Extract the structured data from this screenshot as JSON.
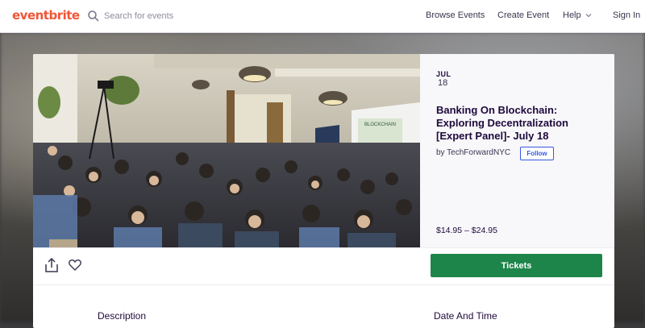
{
  "nav": {
    "logo": "eventbrite",
    "search_placeholder": "Search for events",
    "links": {
      "browse": "Browse Events",
      "create": "Create Event",
      "help": "Help",
      "signin": "Sign In"
    }
  },
  "event": {
    "month": "JUL",
    "day": "18",
    "title": "Banking On Blockchain: Exploring Decentralization [Expert Panel]- July 18",
    "organizer_prefix": "by",
    "organizer": "TechForwardNYC",
    "follow_label": "Follow",
    "price": "$14.95 – $24.95",
    "tickets_label": "Tickets"
  },
  "sections": {
    "description": "Description",
    "date_time": "Date And Time"
  },
  "slide": {
    "text": "BLOCKCHAIN"
  },
  "icons": {
    "search": "search-icon",
    "share": "share-icon",
    "like": "heart-icon",
    "help_chevron": "chevron-down-icon"
  },
  "colors": {
    "brand": "#f05537",
    "tickets": "#1e854a",
    "follow": "#3659e3",
    "title": "#1e0a3c"
  }
}
